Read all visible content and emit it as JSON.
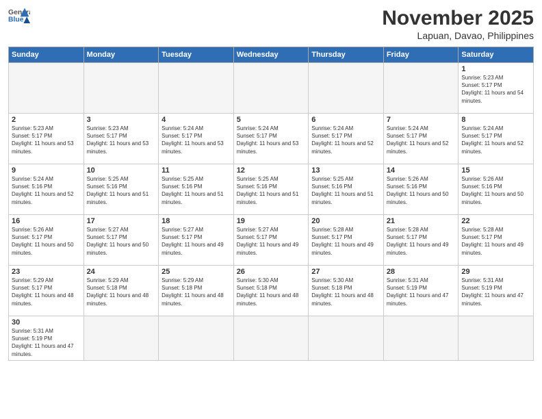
{
  "header": {
    "logo_general": "General",
    "logo_blue": "Blue",
    "title": "November 2025",
    "location": "Lapuan, Davao, Philippines"
  },
  "days_of_week": [
    "Sunday",
    "Monday",
    "Tuesday",
    "Wednesday",
    "Thursday",
    "Friday",
    "Saturday"
  ],
  "weeks": [
    {
      "cells": [
        {
          "empty": true
        },
        {
          "empty": true
        },
        {
          "empty": true
        },
        {
          "empty": true
        },
        {
          "empty": true
        },
        {
          "empty": true
        },
        {
          "day": 1,
          "sunrise": "Sunrise: 5:23 AM",
          "sunset": "Sunset: 5:17 PM",
          "daylight": "Daylight: 11 hours and 54 minutes."
        }
      ]
    },
    {
      "cells": [
        {
          "day": 2,
          "sunrise": "Sunrise: 5:23 AM",
          "sunset": "Sunset: 5:17 PM",
          "daylight": "Daylight: 11 hours and 53 minutes."
        },
        {
          "day": 3,
          "sunrise": "Sunrise: 5:23 AM",
          "sunset": "Sunset: 5:17 PM",
          "daylight": "Daylight: 11 hours and 53 minutes."
        },
        {
          "day": 4,
          "sunrise": "Sunrise: 5:24 AM",
          "sunset": "Sunset: 5:17 PM",
          "daylight": "Daylight: 11 hours and 53 minutes."
        },
        {
          "day": 5,
          "sunrise": "Sunrise: 5:24 AM",
          "sunset": "Sunset: 5:17 PM",
          "daylight": "Daylight: 11 hours and 53 minutes."
        },
        {
          "day": 6,
          "sunrise": "Sunrise: 5:24 AM",
          "sunset": "Sunset: 5:17 PM",
          "daylight": "Daylight: 11 hours and 52 minutes."
        },
        {
          "day": 7,
          "sunrise": "Sunrise: 5:24 AM",
          "sunset": "Sunset: 5:17 PM",
          "daylight": "Daylight: 11 hours and 52 minutes."
        },
        {
          "day": 8,
          "sunrise": "Sunrise: 5:24 AM",
          "sunset": "Sunset: 5:17 PM",
          "daylight": "Daylight: 11 hours and 52 minutes."
        }
      ]
    },
    {
      "cells": [
        {
          "day": 9,
          "sunrise": "Sunrise: 5:24 AM",
          "sunset": "Sunset: 5:16 PM",
          "daylight": "Daylight: 11 hours and 52 minutes."
        },
        {
          "day": 10,
          "sunrise": "Sunrise: 5:25 AM",
          "sunset": "Sunset: 5:16 PM",
          "daylight": "Daylight: 11 hours and 51 minutes."
        },
        {
          "day": 11,
          "sunrise": "Sunrise: 5:25 AM",
          "sunset": "Sunset: 5:16 PM",
          "daylight": "Daylight: 11 hours and 51 minutes."
        },
        {
          "day": 12,
          "sunrise": "Sunrise: 5:25 AM",
          "sunset": "Sunset: 5:16 PM",
          "daylight": "Daylight: 11 hours and 51 minutes."
        },
        {
          "day": 13,
          "sunrise": "Sunrise: 5:25 AM",
          "sunset": "Sunset: 5:16 PM",
          "daylight": "Daylight: 11 hours and 51 minutes."
        },
        {
          "day": 14,
          "sunrise": "Sunrise: 5:26 AM",
          "sunset": "Sunset: 5:16 PM",
          "daylight": "Daylight: 11 hours and 50 minutes."
        },
        {
          "day": 15,
          "sunrise": "Sunrise: 5:26 AM",
          "sunset": "Sunset: 5:16 PM",
          "daylight": "Daylight: 11 hours and 50 minutes."
        }
      ]
    },
    {
      "cells": [
        {
          "day": 16,
          "sunrise": "Sunrise: 5:26 AM",
          "sunset": "Sunset: 5:17 PM",
          "daylight": "Daylight: 11 hours and 50 minutes."
        },
        {
          "day": 17,
          "sunrise": "Sunrise: 5:27 AM",
          "sunset": "Sunset: 5:17 PM",
          "daylight": "Daylight: 11 hours and 50 minutes."
        },
        {
          "day": 18,
          "sunrise": "Sunrise: 5:27 AM",
          "sunset": "Sunset: 5:17 PM",
          "daylight": "Daylight: 11 hours and 49 minutes."
        },
        {
          "day": 19,
          "sunrise": "Sunrise: 5:27 AM",
          "sunset": "Sunset: 5:17 PM",
          "daylight": "Daylight: 11 hours and 49 minutes."
        },
        {
          "day": 20,
          "sunrise": "Sunrise: 5:28 AM",
          "sunset": "Sunset: 5:17 PM",
          "daylight": "Daylight: 11 hours and 49 minutes."
        },
        {
          "day": 21,
          "sunrise": "Sunrise: 5:28 AM",
          "sunset": "Sunset: 5:17 PM",
          "daylight": "Daylight: 11 hours and 49 minutes."
        },
        {
          "day": 22,
          "sunrise": "Sunrise: 5:28 AM",
          "sunset": "Sunset: 5:17 PM",
          "daylight": "Daylight: 11 hours and 49 minutes."
        }
      ]
    },
    {
      "cells": [
        {
          "day": 23,
          "sunrise": "Sunrise: 5:29 AM",
          "sunset": "Sunset: 5:17 PM",
          "daylight": "Daylight: 11 hours and 48 minutes."
        },
        {
          "day": 24,
          "sunrise": "Sunrise: 5:29 AM",
          "sunset": "Sunset: 5:18 PM",
          "daylight": "Daylight: 11 hours and 48 minutes."
        },
        {
          "day": 25,
          "sunrise": "Sunrise: 5:29 AM",
          "sunset": "Sunset: 5:18 PM",
          "daylight": "Daylight: 11 hours and 48 minutes."
        },
        {
          "day": 26,
          "sunrise": "Sunrise: 5:30 AM",
          "sunset": "Sunset: 5:18 PM",
          "daylight": "Daylight: 11 hours and 48 minutes."
        },
        {
          "day": 27,
          "sunrise": "Sunrise: 5:30 AM",
          "sunset": "Sunset: 5:18 PM",
          "daylight": "Daylight: 11 hours and 48 minutes."
        },
        {
          "day": 28,
          "sunrise": "Sunrise: 5:31 AM",
          "sunset": "Sunset: 5:19 PM",
          "daylight": "Daylight: 11 hours and 47 minutes."
        },
        {
          "day": 29,
          "sunrise": "Sunrise: 5:31 AM",
          "sunset": "Sunset: 5:19 PM",
          "daylight": "Daylight: 11 hours and 47 minutes."
        }
      ]
    },
    {
      "cells": [
        {
          "day": 30,
          "sunrise": "Sunrise: 5:31 AM",
          "sunset": "Sunset: 5:19 PM",
          "daylight": "Daylight: 11 hours and 47 minutes."
        },
        {
          "empty": true
        },
        {
          "empty": true
        },
        {
          "empty": true
        },
        {
          "empty": true
        },
        {
          "empty": true
        },
        {
          "empty": true
        }
      ]
    }
  ]
}
